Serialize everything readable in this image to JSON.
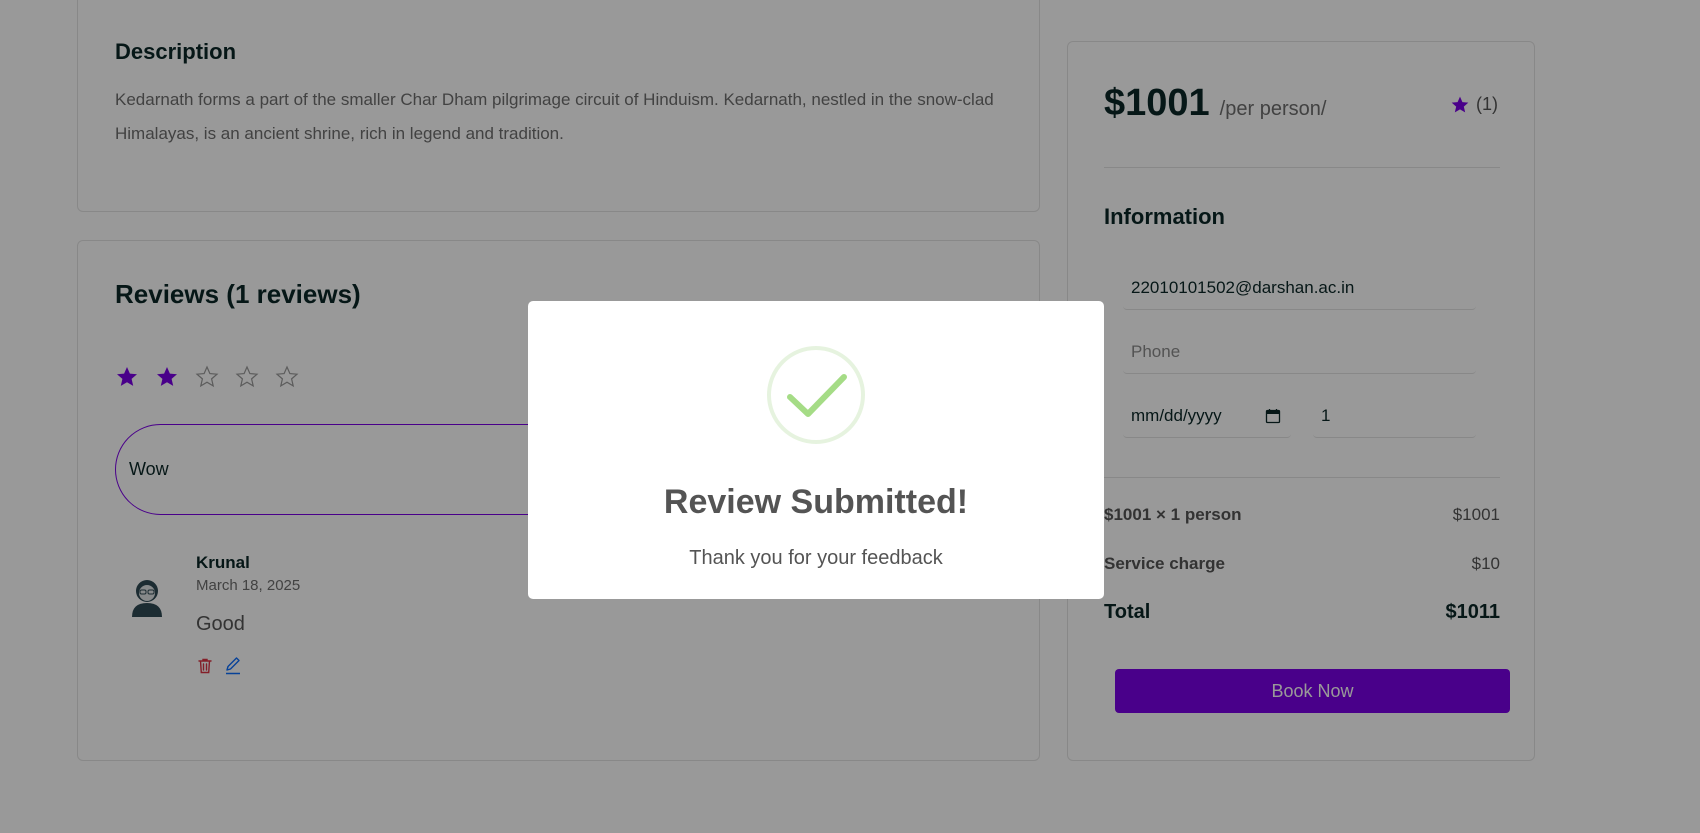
{
  "description": {
    "title": "Description",
    "text": "Kedarnath forms a part of the smaller Char Dham pilgrimage circuit of Hinduism. Kedarnath, nestled in the snow-clad Himalayas, is an ancient shrine, rich in legend and tradition."
  },
  "reviews": {
    "title": "Reviews (1 reviews)",
    "star_rating_selected": 2,
    "star_rating_max": 5,
    "input_value": "Wow",
    "items": [
      {
        "name": "Krunal",
        "date": "March 18, 2025",
        "text": "Good"
      }
    ]
  },
  "booking": {
    "price": "$1001",
    "price_unit": "/per person/",
    "rating_count": "(1)",
    "info_title": "Information",
    "email_value": "22010101502@darshan.ac.in",
    "phone_placeholder": "Phone",
    "date_placeholder": "mm/dd/yyyy",
    "guests_value": "1",
    "line_price_label": "$1001 × 1 person",
    "line_price_value": "$1001",
    "service_label": "Service charge",
    "service_value": "$10",
    "total_label": "Total",
    "total_value": "$1011",
    "book_button": "Book Now"
  },
  "modal": {
    "title": "Review Submitted!",
    "text": "Thank you for your feedback",
    "icon": "success-check-icon"
  },
  "colors": {
    "accent": "#7b00e6",
    "heading": "#0b2727",
    "success": "#a5dc86",
    "delete": "#dc3545",
    "edit": "#0d6efd"
  }
}
